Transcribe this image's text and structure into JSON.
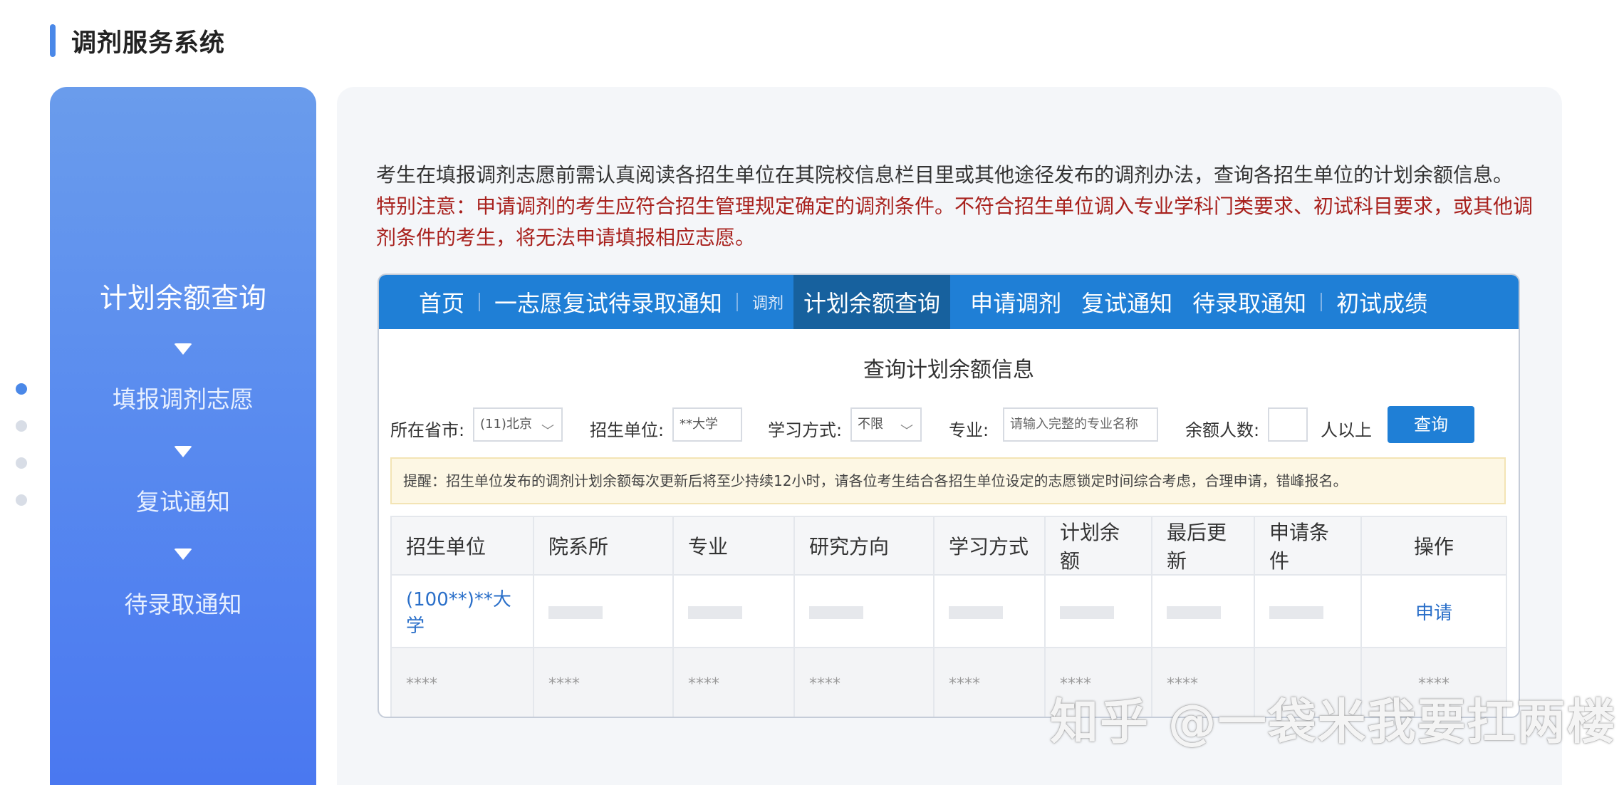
{
  "page": {
    "section_title": "调剂服务系统"
  },
  "steps": {
    "items": [
      "计划余额查询",
      "填报调剂志愿",
      "复试通知",
      "待录取通知"
    ],
    "current": 0
  },
  "intro": {
    "line1": "考生在填报调剂志愿前需认真阅读各招生单位在其院校信息栏目里或其他途径发布的调剂办法，查询各招生单位的计划余额信息。",
    "notice": "特别注意：申请调剂的考生应符合招生管理规定确定的调剂条件。不符合招生单位调入专业学科门类要求、初试科目要求，或其他调剂条件的考生，将无法申请填报相应志愿。"
  },
  "nav": {
    "items": [
      "首页",
      "一志愿复试待录取通知",
      "调剂",
      "计划余额查询",
      "申请调剂",
      "复试通知",
      "待录取通知",
      "初试成绩"
    ],
    "active": "计划余额查询"
  },
  "query": {
    "title": "查询计划余额信息",
    "province_label": "所在省市:",
    "province_value": "(11)北京",
    "unit_label": "招生单位:",
    "unit_value": "**大学",
    "mode_label": "学习方式:",
    "mode_value": "不限",
    "major_label": "专业:",
    "major_placeholder": "请输入完整的专业名称",
    "remain_label": "余额人数:",
    "remain_value": "",
    "remain_suffix": "人以上",
    "button": "查询"
  },
  "reminder": "提醒：招生单位发布的调剂计划余额每次更新后将至少持续12小时，请各位考生结合各招生单位设定的志愿锁定时间综合考虑，合理申请，错峰报名。",
  "table": {
    "headers": [
      "招生单位",
      "院系所",
      "专业",
      "研究方向",
      "学习方式",
      "计划余额",
      "最后更新",
      "申请条件",
      "操作"
    ],
    "row1_unit": "(100**)**大学",
    "row1_action": "申请",
    "mask": "****"
  },
  "watermark": "知乎 @一袋米我要扛两楼",
  "colors": {
    "accent": "#1f7fd6",
    "notice": "#a8211d",
    "link": "#2a6fc9"
  },
  "icons": [
    "chevron-down-icon",
    "dropdown-caret-icon"
  ]
}
